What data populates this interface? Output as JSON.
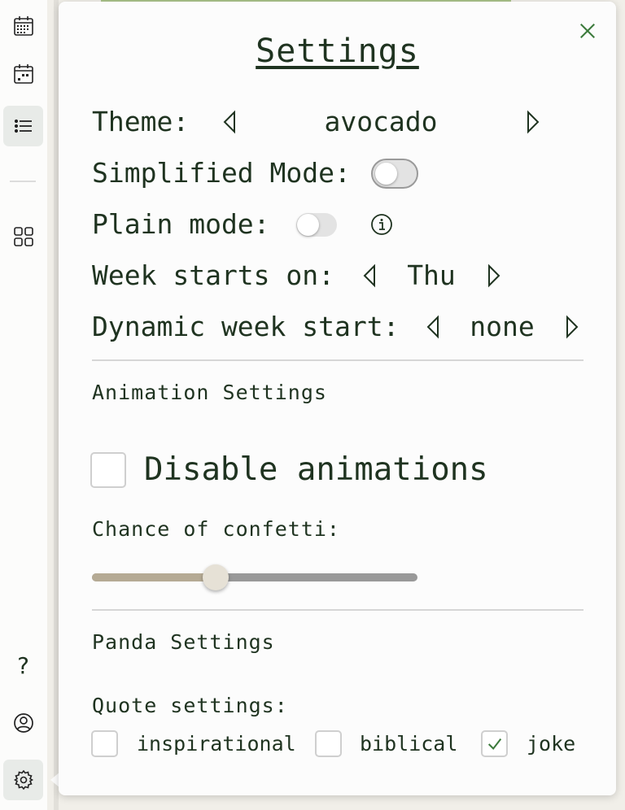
{
  "sidebar": {
    "icons": [
      "calendar-month-icon",
      "calendar-week-icon",
      "list-icon",
      "grid-icon",
      "help-icon",
      "account-icon",
      "settings-gear-icon"
    ],
    "active": "list-icon",
    "help_glyph": "?"
  },
  "settings": {
    "title": "Settings",
    "theme": {
      "label": "Theme:",
      "value": "avocado"
    },
    "simplified_mode": {
      "label": "Simplified Mode:",
      "on": false
    },
    "plain_mode": {
      "label": "Plain mode:",
      "on": false
    },
    "week_start": {
      "label": "Week starts on:",
      "value": "Thu"
    },
    "dynamic_week_start": {
      "label": "Dynamic week start:",
      "value": "none"
    },
    "animation": {
      "heading": "Animation Settings",
      "disable_label": "Disable animations",
      "disable_checked": false,
      "confetti_label": "Chance of confetti:",
      "confetti_level": 0.38
    },
    "panda": {
      "heading": "Panda Settings",
      "quote_label": "Quote settings:",
      "quotes": [
        {
          "label": "inspirational",
          "checked": false
        },
        {
          "label": "biblical",
          "checked": false
        },
        {
          "label": "joke",
          "checked": true
        }
      ]
    }
  },
  "colors": {
    "text": "#1f3320",
    "accent_green": "#3b7a3b",
    "slider_fill": "#b5aa94",
    "slider_track": "#999999"
  }
}
